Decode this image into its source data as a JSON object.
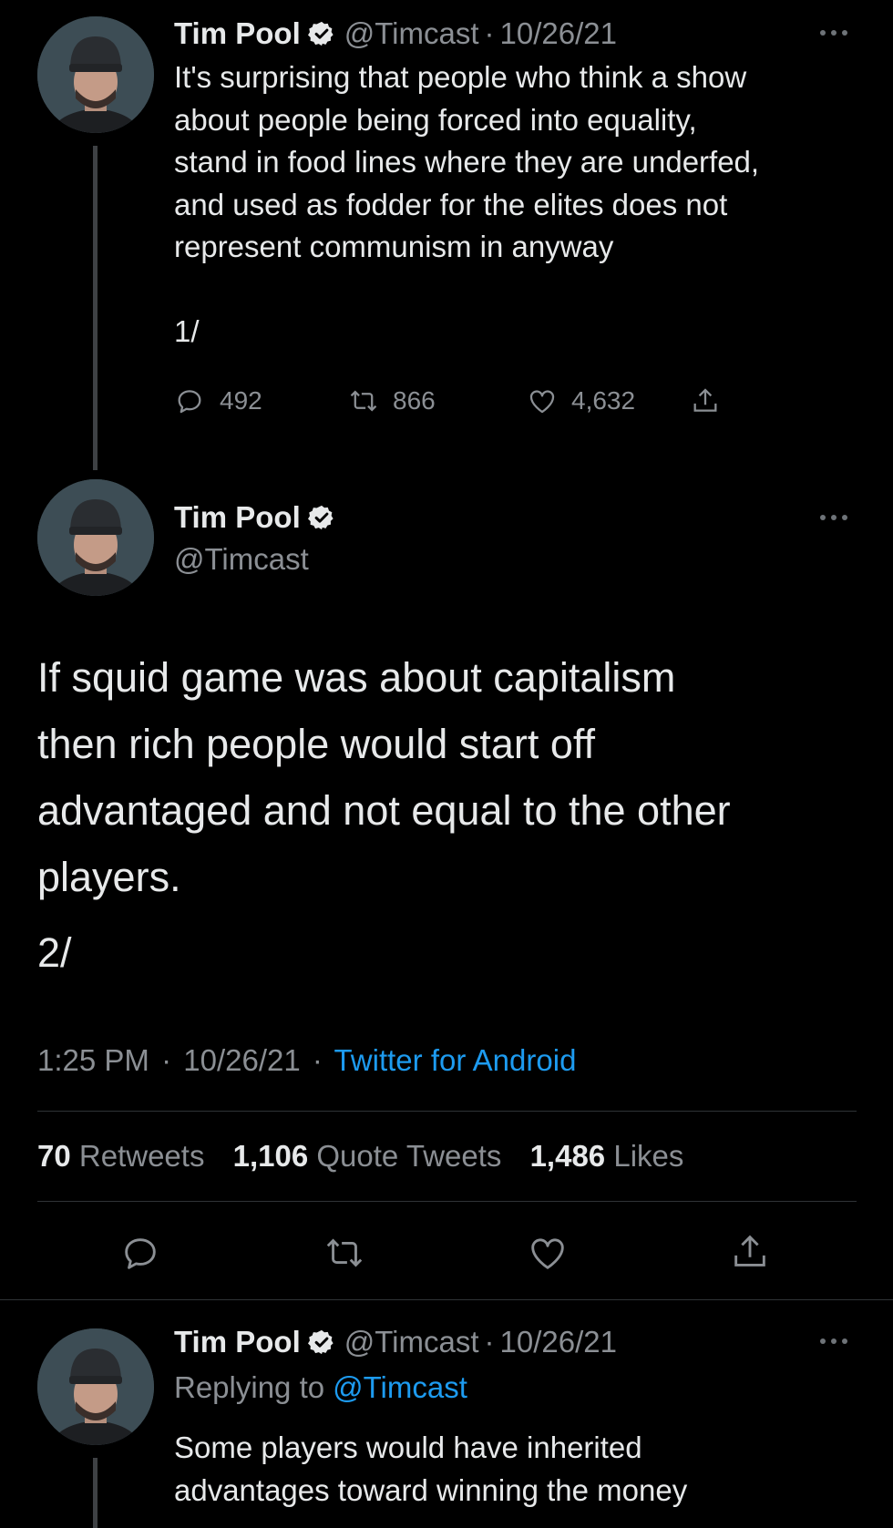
{
  "tweet1": {
    "author_name": "Tim Pool",
    "handle": "@Timcast",
    "separator": "·",
    "date": "10/26/21",
    "text_lines": [
      "It's surprising that people who think a show",
      "about people being forced into equality,",
      "stand in food lines where they are underfed,",
      "and used as fodder for the elites does not",
      "represent communism in anyway"
    ],
    "thread_marker": "1/",
    "replies": "492",
    "retweets": "866",
    "likes": "4,632"
  },
  "main_tweet": {
    "author_name": "Tim Pool",
    "handle": "@Timcast",
    "text_lines": [
      "If squid game was about capitalism",
      "then rich people would start off",
      "advantaged and not equal to the other",
      "players."
    ],
    "thread_marker": "2/",
    "time": "1:25 PM",
    "separator": "·",
    "date": "10/26/21",
    "source": "Twitter for Android",
    "stats": {
      "retweets_count": "70",
      "retweets_label": "Retweets",
      "quotes_count": "1,106",
      "quotes_label": "Quote Tweets",
      "likes_count": "1,486",
      "likes_label": "Likes"
    }
  },
  "tweet3": {
    "author_name": "Tim Pool",
    "handle": "@Timcast",
    "separator": "·",
    "date": "10/26/21",
    "replying_prefix": "Replying to",
    "replying_to": "@Timcast",
    "text_lines": [
      "Some players would have inherited",
      "advantages toward winning the money"
    ]
  },
  "colors": {
    "background": "#000000",
    "text": "#e7e9ea",
    "secondary": "#8b8f94",
    "accent": "#1d9bf0",
    "verified_badge": "#e7e9ea"
  },
  "icons": [
    "verified-icon",
    "more-icon",
    "reply-icon",
    "retweet-icon",
    "like-icon",
    "share-icon"
  ]
}
